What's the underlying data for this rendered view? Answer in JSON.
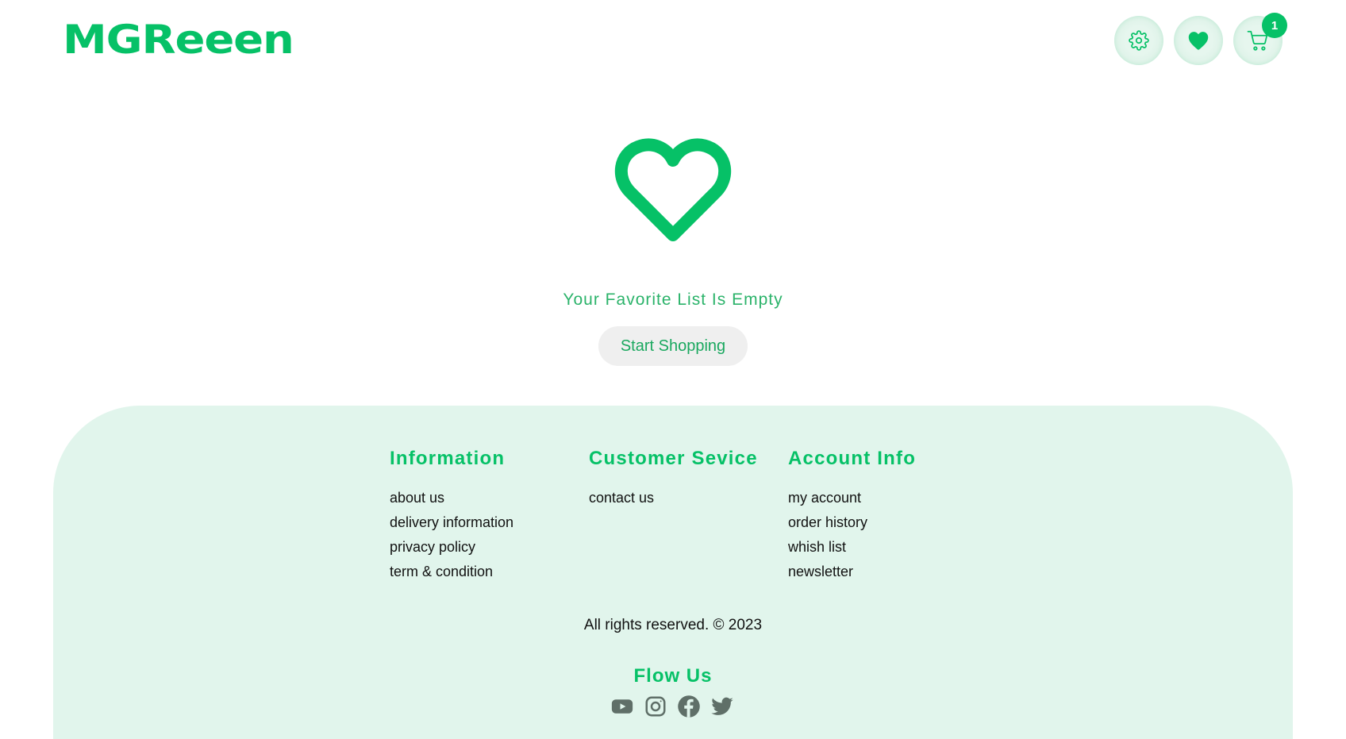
{
  "header": {
    "logo": "MGReeen",
    "cart_count": "1"
  },
  "empty_state": {
    "message": "Your Favorite List Is Empty",
    "button_label": "Start Shopping"
  },
  "footer": {
    "columns": [
      {
        "title": "Information",
        "links": [
          "about us",
          "delivery information",
          "privacy policy",
          "term & condition"
        ]
      },
      {
        "title": "Customer Sevice",
        "links": [
          "contact us"
        ]
      },
      {
        "title": "Account Info",
        "links": [
          "my account",
          "order history",
          "whish list",
          "newsletter"
        ]
      }
    ],
    "copyright": "All rights reserved. © 2023",
    "follow_title": "Flow Us",
    "socials": [
      "youtube-icon",
      "instagram-icon",
      "facebook-icon",
      "twitter-icon"
    ]
  },
  "colors": {
    "brand_green": "#06c167",
    "footer_bg": "#e1f5ec",
    "icon_gray": "#5f6f68"
  }
}
